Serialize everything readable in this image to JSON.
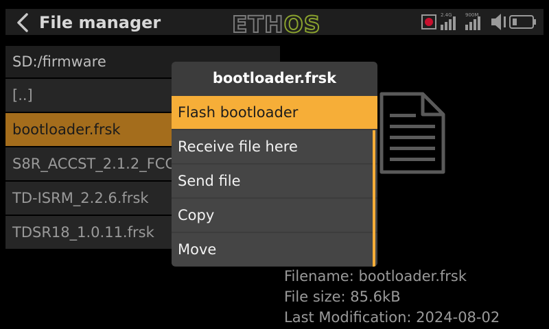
{
  "header": {
    "title": "File manager",
    "logo_main": "ETH",
    "logo_accent": "OS",
    "rx1_label": "2.4G",
    "rx2_label": "900M"
  },
  "browser": {
    "path": "SD:/firmware",
    "files": [
      {
        "label": "[..]"
      },
      {
        "label": "bootloader.frsk",
        "selected": true
      },
      {
        "label": "S8R_ACCST_2.1.2_FCC.frk"
      },
      {
        "label": "TD-ISRM_2.2.6.frsk"
      },
      {
        "label": "TDSR18_1.0.11.frsk"
      }
    ]
  },
  "info": {
    "filename": "Filename: bootloader.frsk",
    "filesize": "File size: 85.6kB",
    "modified": "Last Modification: 2024-08-02"
  },
  "dialog": {
    "title": "bootloader.frsk",
    "items": [
      {
        "label": "Flash bootloader",
        "active": true
      },
      {
        "label": "Receive file here"
      },
      {
        "label": "Send file"
      },
      {
        "label": "Copy"
      },
      {
        "label": "Move"
      }
    ]
  },
  "colors": {
    "accent": "#f6ae38",
    "selected_row": "#a46d1c",
    "record": "#c8102e",
    "logo_green": "#8aa22e"
  }
}
